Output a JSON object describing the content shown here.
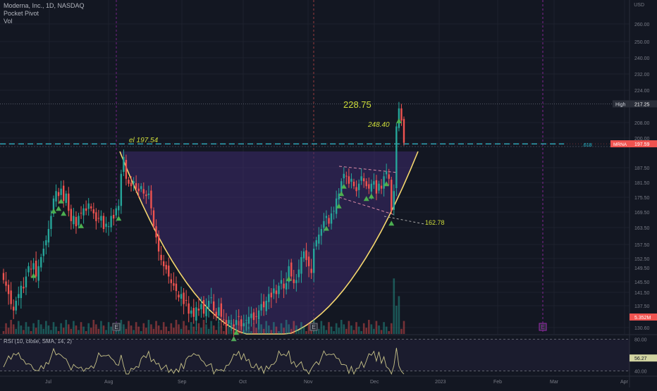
{
  "header": {
    "symbol_line": "Moderna, Inc., 1D, NASDAQ",
    "indicator_1": "Pocket Pivot",
    "indicator_2": "Vol",
    "currency": "USD"
  },
  "rsi_panel": {
    "label": "RSI (10, close, SMA, 14, 2)",
    "levels": [
      "80.00",
      "40.00"
    ],
    "current_value": "56.27"
  },
  "annotations": {
    "big_label": "228.75",
    "italic_label": "248.40",
    "level_label": "el 197.54",
    "target_label": "162.78",
    "fib_label": ".618"
  },
  "badges": {
    "high_label": "High",
    "high_value": "217.25",
    "symbol_tag": "MRNA",
    "last_price": "197.59",
    "volume_value": "5.352M"
  },
  "colors": {
    "background": "#131722",
    "up_candle": "#26a69a",
    "down_candle": "#ef5350",
    "cup_fill": "#3d2a6b",
    "cup_line": "#f5d76e",
    "annotation": "#cddc39",
    "fib_line": "#26c6da",
    "pivot_marker": "#4caf50",
    "rsi_line": "#c8c389",
    "event_line": "#9c27b0"
  },
  "chart_data": {
    "type": "candlestick",
    "title": "Moderna, Inc., 1D, NASDAQ",
    "x_tick_labels": [
      "Jul",
      "Aug",
      "Sep",
      "Oct",
      "Nov",
      "Dec",
      "2023",
      "Feb",
      "Mar",
      "Apr"
    ],
    "y_tick_labels": [
      "260.00",
      "250.00",
      "240.00",
      "232.00",
      "224.00",
      "208.00",
      "200.00",
      "187.50",
      "181.50",
      "175.50",
      "169.50",
      "163.50",
      "157.50",
      "152.50",
      "149.50",
      "145.50",
      "141.50",
      "137.50",
      "130.60"
    ],
    "y_ticks": [
      260,
      250,
      240,
      232,
      224,
      208,
      200,
      187.5,
      181.5,
      175.5,
      169.5,
      163.5,
      157.5,
      152.5,
      149.5,
      145.5,
      141.5,
      137.5,
      130.6
    ],
    "ylim": [
      130,
      262
    ],
    "series": [
      {
        "name": "MRNA",
        "closes": [
          146,
          144,
          141,
          138,
          136,
          139,
          141,
          144,
          143,
          147,
          150,
          149,
          151,
          147,
          150,
          153,
          156,
          159,
          163,
          168,
          175,
          178,
          176,
          179,
          174,
          177,
          170,
          166,
          168,
          164,
          168,
          169,
          171,
          170,
          173,
          171,
          169,
          166,
          167,
          168,
          163,
          165,
          164,
          168,
          167,
          171,
          172,
          185,
          192,
          183,
          181,
          180,
          182,
          179,
          178,
          180,
          177,
          176,
          177,
          171,
          164,
          160,
          155,
          152,
          150,
          149,
          147,
          145,
          144,
          142,
          140,
          141,
          138,
          139,
          135,
          136,
          134,
          137,
          136,
          138,
          135,
          137,
          139,
          140,
          136,
          134,
          137,
          134,
          133,
          131,
          133,
          132,
          131,
          133,
          134,
          131,
          132,
          133,
          134,
          135,
          133,
          134,
          136,
          138,
          137,
          139,
          141,
          140,
          143,
          141,
          144,
          146,
          143,
          145,
          150,
          147,
          145,
          146,
          149,
          153,
          155,
          152,
          150,
          148,
          156,
          159,
          161,
          163,
          166,
          168,
          165,
          169,
          170,
          175,
          177,
          182,
          185,
          184,
          181,
          183,
          180,
          178,
          181,
          184,
          182,
          180,
          179,
          181,
          182,
          177,
          181,
          179,
          184,
          186,
          183,
          170,
          178,
          206,
          215,
          209,
          198
        ],
        "ylim": [
          130,
          262
        ]
      }
    ],
    "volume_series": {
      "name": "Vol",
      "current": "5.352M"
    },
    "rsi_series": {
      "name": "RSI (10, close, SMA, 14, 2)",
      "levels": [
        80,
        40
      ],
      "ylim": [
        35,
        85
      ],
      "current": 56.27
    },
    "annotations": [
      {
        "text": "228.75"
      },
      {
        "text": "248.40"
      },
      {
        "text": "el 197.54",
        "value": 197.54
      },
      {
        "text": "162.78",
        "value": 162.78
      },
      {
        "text": ".618"
      }
    ],
    "high_value": 217.25,
    "last_price": 197.59,
    "grid": true
  }
}
